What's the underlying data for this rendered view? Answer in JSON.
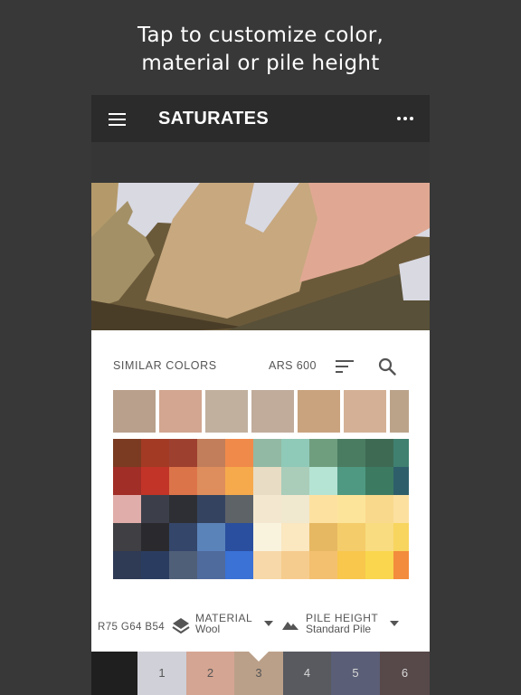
{
  "caption": {
    "line1": "Tap to customize color,",
    "line2": "material or pile height"
  },
  "appbar": {
    "title": "SATURATES",
    "menu_icon": "menu-icon",
    "more_icon": "more-icon"
  },
  "panel": {
    "similar_label": "SIMILAR COLORS",
    "ars_label": "ARS 600",
    "similar_swatches": [
      "#b8a08c",
      "#d2a690",
      "#c1b09e",
      "#c1ac9b",
      "#c9a37e",
      "#d4b196",
      "#bba38a"
    ],
    "grid_colors": [
      [
        "#7a3b22",
        "#a23a24",
        "#9e4030",
        "#c27e5a",
        "#f08a4a",
        "#92b9a3",
        "#8fc9b8",
        "#6f9e7f",
        "#4a7c61",
        "#3e6a54",
        "#3f8070"
      ],
      [
        "#a12e27",
        "#c23428",
        "#dc744a",
        "#de8e5c",
        "#f6aa4c",
        "#e8dcc4",
        "#a9cdb9",
        "#b5e3d4",
        "#4f9982",
        "#3d7a62",
        "#2e5e6a"
      ],
      [
        "#e0adaa",
        "#3c3f4a",
        "#2e2f35",
        "#344460",
        "#5e6368",
        "#f3e8cf",
        "#f1e8d0",
        "#fce1a1",
        "#fde49b",
        "#f9d98c",
        "#fbe0a0"
      ],
      [
        "#3f3f44",
        "#2a2a2e",
        "#34466a",
        "#5a83ba",
        "#2a4f9e",
        "#f9f3de",
        "#fbe7c0",
        "#e6b862",
        "#f4cc6a",
        "#f9dc80",
        "#f8d55e"
      ],
      [
        "#2f3a55",
        "#2a3d61",
        "#505f78",
        "#4f6a9c",
        "#3a72d6",
        "#f7d8a8",
        "#f6cc8e",
        "#f3c070",
        "#f8c74c",
        "#f9d64e",
        "#f38c3c"
      ]
    ]
  },
  "controls": {
    "code": "R75 G64 B54",
    "material_label": "MATERIAL",
    "material_value": "Wool",
    "pile_label": "PILE HEIGHT",
    "pile_value": "Standard Pile"
  },
  "tabs": [
    {
      "label": "",
      "color": "#1f1f1f",
      "text_color": "#aaaaaa"
    },
    {
      "label": "1",
      "color": "#cfd0d8",
      "text_color": "#555555"
    },
    {
      "label": "2",
      "color": "#d4a592",
      "text_color": "#555555"
    },
    {
      "label": "3",
      "color": "#bba089",
      "text_color": "#555555"
    },
    {
      "label": "4",
      "color": "#585a60",
      "text_color": "#d8d8d8"
    },
    {
      "label": "5",
      "color": "#5a5e76",
      "text_color": "#d8d8d8"
    },
    {
      "label": "6",
      "color": "#57484a",
      "text_color": "#d8d8d8"
    }
  ]
}
